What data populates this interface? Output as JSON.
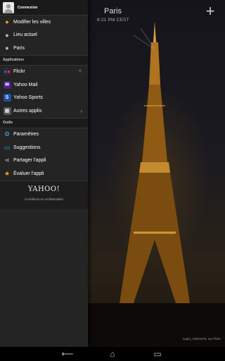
{
  "weather": {
    "city": "Paris",
    "time": "6:21 PM CEST",
    "credit": "super_mike1976, sur Flickr"
  },
  "drawer": {
    "header_label": "Connexion",
    "locations": [
      {
        "label": "Modifier les villes",
        "icon": "location-pin-icon"
      },
      {
        "label": "Lieu actuel",
        "icon": "location-pin-icon"
      },
      {
        "label": "Paris",
        "icon": "location-pin-icon"
      }
    ],
    "apps_section": "Applications",
    "apps": [
      {
        "label": "Flickr",
        "icon": "flickr-icon"
      },
      {
        "label": "Yahoo Mail",
        "icon": "yahoo-mail-icon"
      },
      {
        "label": "Yahoo Sports",
        "icon": "yahoo-sports-icon"
      },
      {
        "label": "Autres applis",
        "icon": "apps-icon"
      }
    ],
    "tools_section": "Outils",
    "tools": [
      {
        "label": "Paramètres",
        "icon": "gear-icon"
      },
      {
        "label": "Suggestions",
        "icon": "chat-icon"
      },
      {
        "label": "Partager l'appli",
        "icon": "share-icon"
      },
      {
        "label": "Évaluer l'appli",
        "icon": "star-icon"
      }
    ],
    "brand": "YAHOO!",
    "terms": "Conditions et confidentialité"
  },
  "colors": {
    "accent_orange": "#f2a21a",
    "accent_blue": "#3ab0e8"
  }
}
